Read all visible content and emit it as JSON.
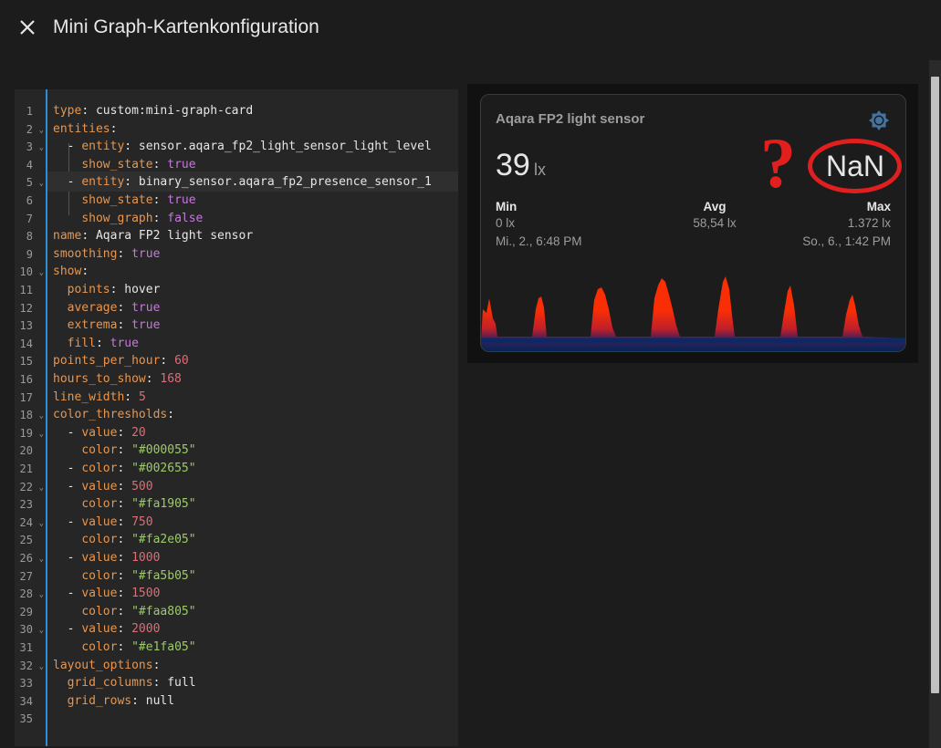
{
  "dialog": {
    "title": "Mini Graph-Kartenkonfiguration",
    "close_icon": "close-icon"
  },
  "editor": {
    "lines": [
      {
        "n": "1",
        "fold": false,
        "html": "<span class='k'>type</span>: custom:mini-graph-card"
      },
      {
        "n": "2",
        "fold": true,
        "html": "<span class='k'>entities</span>:"
      },
      {
        "n": "3",
        "fold": true,
        "html": "  - <span class='k'>entity</span>: sensor.aqara_fp2_light_sensor_light_level"
      },
      {
        "n": "4",
        "fold": false,
        "html": "    <span class='k'>show_state</span>: <span class='b'>true</span>"
      },
      {
        "n": "5",
        "fold": true,
        "active": true,
        "html": "  - <span class='k'>entity</span>: binary_sensor.aqara_fp2_presence_sensor_1"
      },
      {
        "n": "6",
        "fold": false,
        "html": "    <span class='k'>show_state</span>: <span class='b'>true</span>"
      },
      {
        "n": "7",
        "fold": false,
        "html": "    <span class='k'>show_graph</span>: <span class='b'>false</span>"
      },
      {
        "n": "8",
        "fold": false,
        "html": "<span class='k'>name</span>: Aqara FP2 light sensor"
      },
      {
        "n": "9",
        "fold": false,
        "html": "<span class='k'>smoothing</span>: <span class='b'>true</span>"
      },
      {
        "n": "10",
        "fold": true,
        "html": "<span class='k'>show</span>:"
      },
      {
        "n": "11",
        "fold": false,
        "html": "  <span class='k'>points</span>: hover"
      },
      {
        "n": "12",
        "fold": false,
        "html": "  <span class='k'>average</span>: <span class='b'>true</span>"
      },
      {
        "n": "13",
        "fold": false,
        "html": "  <span class='k'>extrema</span>: <span class='b'>true</span>"
      },
      {
        "n": "14",
        "fold": false,
        "html": "  <span class='k'>fill</span>: <span class='b'>true</span>"
      },
      {
        "n": "15",
        "fold": false,
        "html": "<span class='k'>points_per_hour</span>: <span class='n'>60</span>"
      },
      {
        "n": "16",
        "fold": false,
        "html": "<span class='k'>hours_to_show</span>: <span class='n'>168</span>"
      },
      {
        "n": "17",
        "fold": false,
        "html": "<span class='k'>line_width</span>: <span class='n'>5</span>"
      },
      {
        "n": "18",
        "fold": true,
        "html": "<span class='k'>color_thresholds</span>:"
      },
      {
        "n": "19",
        "fold": true,
        "html": "  - <span class='k'>value</span>: <span class='n'>20</span>"
      },
      {
        "n": "20",
        "fold": false,
        "html": "    <span class='k'>color</span>: <span class='q'>\"#000055\"</span>"
      },
      {
        "n": "21",
        "fold": false,
        "html": "  - <span class='k'>color</span>: <span class='q'>\"#002655\"</span>"
      },
      {
        "n": "22",
        "fold": true,
        "html": "  - <span class='k'>value</span>: <span class='n'>500</span>"
      },
      {
        "n": "23",
        "fold": false,
        "html": "    <span class='k'>color</span>: <span class='q'>\"#fa1905\"</span>"
      },
      {
        "n": "24",
        "fold": true,
        "html": "  - <span class='k'>value</span>: <span class='n'>750</span>"
      },
      {
        "n": "25",
        "fold": false,
        "html": "    <span class='k'>color</span>: <span class='q'>\"#fa2e05\"</span>"
      },
      {
        "n": "26",
        "fold": true,
        "html": "  - <span class='k'>value</span>: <span class='n'>1000</span>"
      },
      {
        "n": "27",
        "fold": false,
        "html": "    <span class='k'>color</span>: <span class='q'>\"#fa5b05\"</span>"
      },
      {
        "n": "28",
        "fold": true,
        "html": "  - <span class='k'>value</span>: <span class='n'>1500</span>"
      },
      {
        "n": "29",
        "fold": false,
        "html": "    <span class='k'>color</span>: <span class='q'>\"#faa805\"</span>"
      },
      {
        "n": "30",
        "fold": true,
        "html": "  - <span class='k'>value</span>: <span class='n'>2000</span>"
      },
      {
        "n": "31",
        "fold": false,
        "html": "    <span class='k'>color</span>: <span class='q'>\"#e1fa05\"</span>"
      },
      {
        "n": "32",
        "fold": true,
        "html": "<span class='k'>layout_options</span>:"
      },
      {
        "n": "33",
        "fold": false,
        "html": "  <span class='k'>grid_columns</span>: full"
      },
      {
        "n": "34",
        "fold": false,
        "html": "  <span class='k'>grid_rows</span>: null"
      },
      {
        "n": "35",
        "fold": false,
        "html": ""
      }
    ]
  },
  "card": {
    "name": "Aqara FP2 light sensor",
    "icon": "brightness-icon",
    "state": "39",
    "unit": "lx",
    "second_state": "NaN",
    "annotation": "?",
    "min_label": "Min",
    "min_value": "0 lx",
    "min_time": "Mi., 2., 6:48 PM",
    "avg_label": "Avg",
    "avg_value": "58,54 lx",
    "max_label": "Max",
    "max_value": "1.372 lx",
    "max_time": "So., 6., 1:42 PM",
    "colors": {
      "accent": "#44739e",
      "annotation": "#e11f1f",
      "peak": "#fa2e05",
      "base": "#002655"
    }
  }
}
